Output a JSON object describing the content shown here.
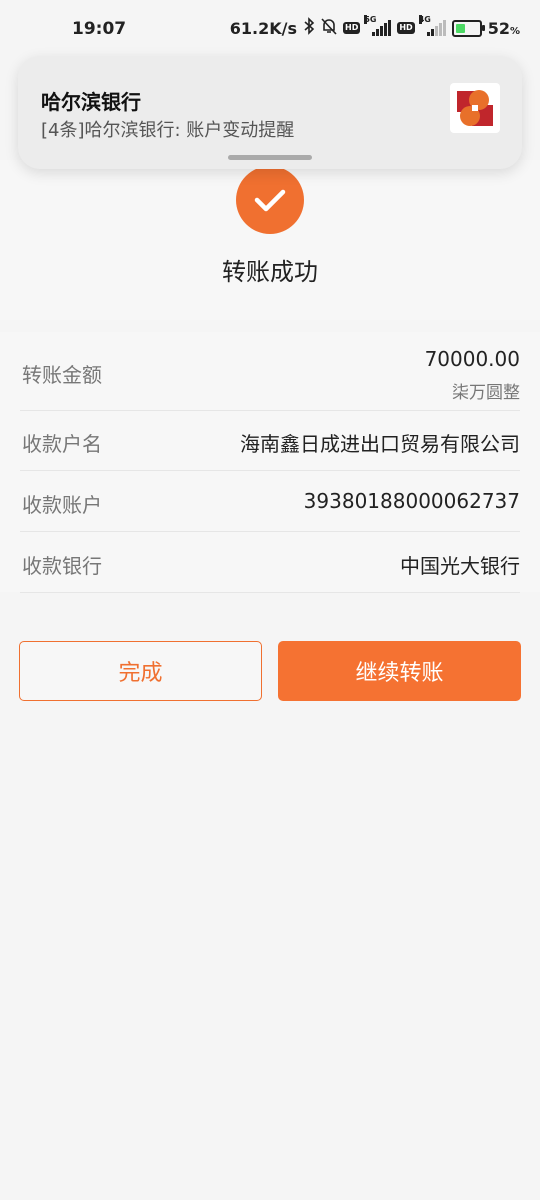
{
  "status_bar": {
    "time": "19:07",
    "speed": "61.2K/s",
    "icons": [
      "bluetooth-icon",
      "mute-bell-icon",
      "hd-icon",
      "signal-5g-icon",
      "hd-icon",
      "signal-4g-icon",
      "battery-icon"
    ],
    "hd_label": "HD",
    "net1": "5G",
    "net2": "4G",
    "battery_level": 0.52,
    "battery_pct": "52",
    "battery_unit": "%"
  },
  "notification": {
    "title": "哈尔滨银行",
    "body": "[4条]哈尔滨银行: 账户变动提醒",
    "logo_icon": "harbin-bank-logo-icon",
    "logo_colors": [
      "#c0262c",
      "#e8702a"
    ]
  },
  "result": {
    "icon": "checkmark-icon",
    "text": "转账成功",
    "accent": "#f07030"
  },
  "details": {
    "amount_label": "转账金额",
    "amount_value": "70000.00",
    "amount_words": "柒万圆整",
    "payee_name_label": "收款户名",
    "payee_name_value": "海南鑫日成进出口贸易有限公司",
    "payee_account_label": "收款账户",
    "payee_account_value": "39380188000062737",
    "payee_bank_label": "收款银行",
    "payee_bank_value": "中国光大银行"
  },
  "actions": {
    "done_label": "完成",
    "continue_label": "继续转账",
    "primary_color": "#f57232"
  }
}
